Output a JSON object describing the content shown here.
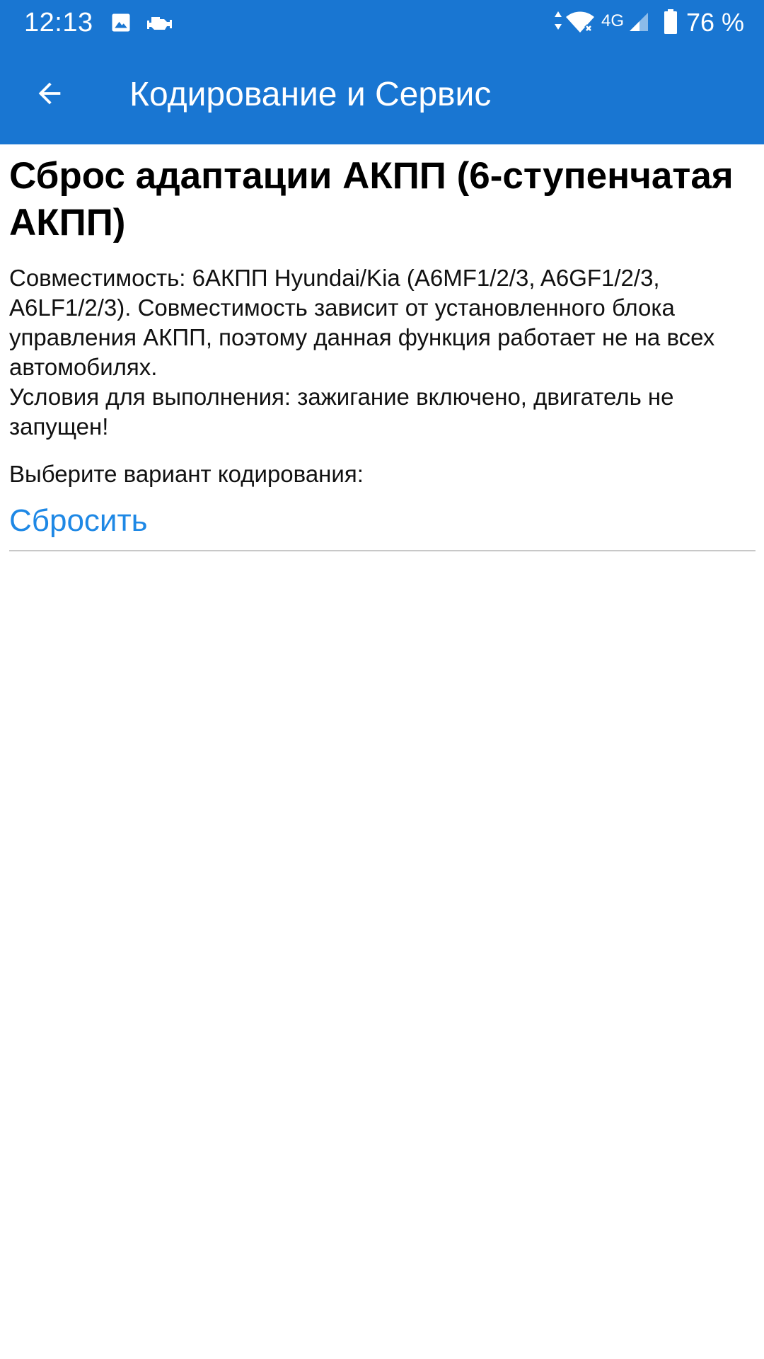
{
  "status_bar": {
    "time": "12:13",
    "network": "4G",
    "battery": "76 %",
    "icons": [
      "image-icon",
      "car-engine-icon",
      "data-arrows-icon",
      "wifi-icon",
      "signal-icon",
      "battery-icon"
    ]
  },
  "toolbar": {
    "back_icon": "arrow-back-icon",
    "title": "Кодирование и Сервис"
  },
  "page": {
    "title": "Сброс адаптации АКПП (6-ступенчатая АКПП)",
    "description": [
      "Совместимость: 6АКПП Hyundai/Kia (A6MF1/2/3, A6GF1/2/3, A6LF1/2/3). Совместимость зависит от установленного блока управления АКПП, поэтому данная функция работает не на всех автомобилях.",
      "Условия для выполнения: зажигание включено, двигатель не запущен!"
    ],
    "prompt": "Выберите вариант кодирования:",
    "options": [
      "Сбросить"
    ]
  },
  "colors": {
    "primary": "#1976d2",
    "accent_link": "#1e88e5",
    "divider": "#c8c8c8"
  }
}
